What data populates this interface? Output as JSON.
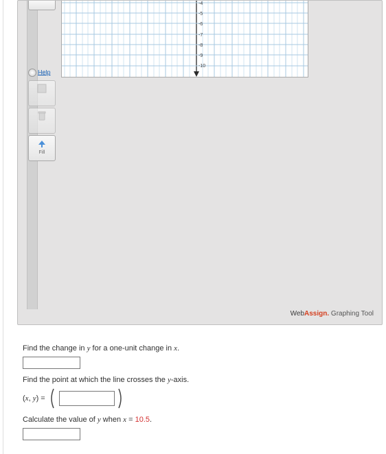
{
  "sidebar": {
    "help": "Help",
    "tools": [
      {
        "name": "grid-tool",
        "label": ""
      },
      {
        "name": "line-tool",
        "label": ""
      },
      {
        "name": "delete-tool",
        "label": ""
      },
      {
        "name": "fill-tool",
        "label": "Fill"
      }
    ]
  },
  "graph": {
    "y_ticks": [
      -4,
      -5,
      -6,
      -7,
      -8,
      -9,
      -10
    ]
  },
  "brand": {
    "part1": "Web",
    "part2": "Assign.",
    "tail": " Graphing Tool"
  },
  "q1": {
    "text_a": "Find the change in ",
    "var_y": "y",
    "text_b": " for a one-unit change in ",
    "var_x": "x",
    "text_c": "."
  },
  "q2": {
    "text_a": "Find the point at which the line crosses the ",
    "var_y": "y",
    "text_b": "-axis.",
    "lhs_open": "(",
    "lhs_x": "x",
    "lhs_comma": ", ",
    "lhs_y": "y",
    "lhs_close_eq": ") ="
  },
  "q3": {
    "text_a": "Calculate the value of ",
    "var_y": "y",
    "text_b": " when ",
    "var_x": "x",
    "text_c": " = ",
    "val": "10.5",
    "text_d": "."
  },
  "chart_data": {
    "type": "line",
    "title": "",
    "xlabel": "",
    "ylabel": "",
    "y_ticks_visible": [
      -4,
      -5,
      -6,
      -7,
      -8,
      -9,
      -10
    ],
    "xlim": [
      -10,
      10
    ],
    "ylim": [
      -10,
      10
    ],
    "series": []
  }
}
